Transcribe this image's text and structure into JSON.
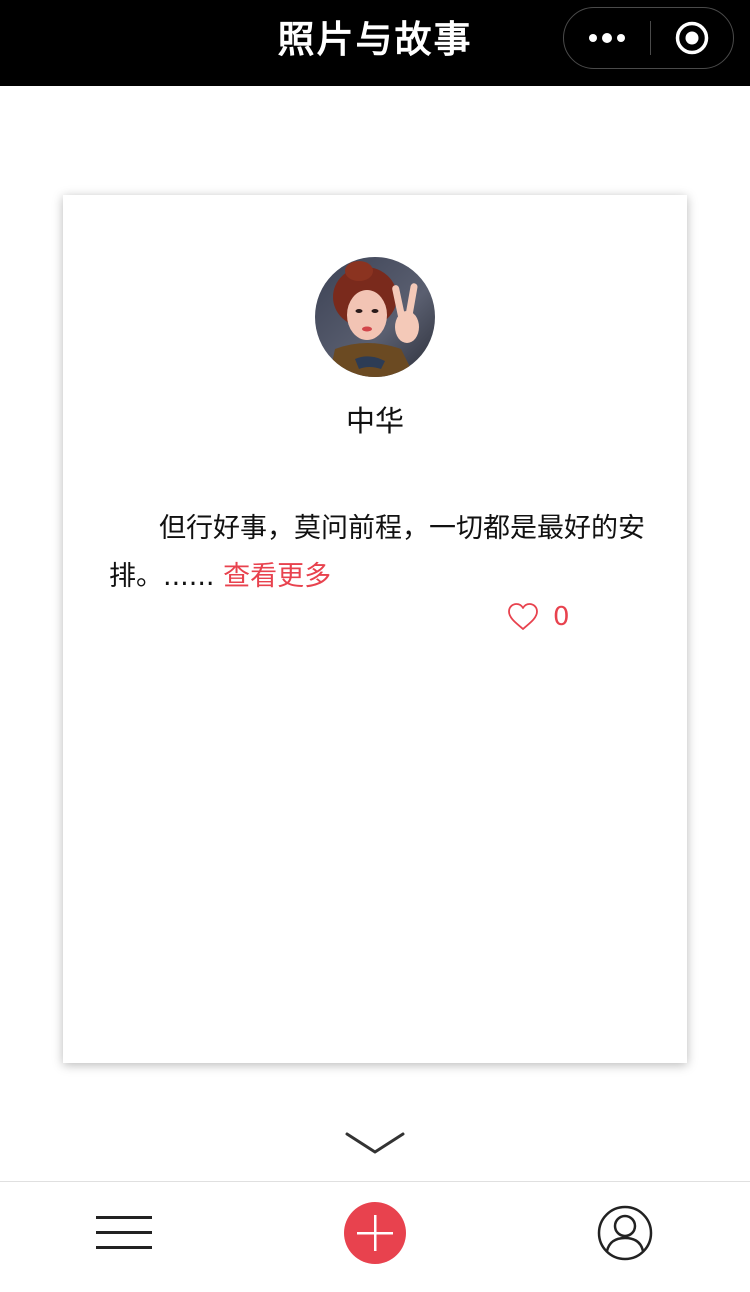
{
  "navbar": {
    "title": "照片与故事",
    "more_icon": "ellipsis-icon",
    "close_icon": "target-circle-icon"
  },
  "card": {
    "author": "中华",
    "story_text": "但行好事，莫问前程，一切都是最好的安排。......",
    "more_link": "查看更多",
    "like_count": "0",
    "like_icon": "heart-outline-icon"
  },
  "tabbar": {
    "items": [
      {
        "icon": "menu-icon"
      },
      {
        "icon": "add-icon"
      },
      {
        "icon": "user-icon"
      }
    ]
  },
  "colors": {
    "accent": "#e8424e",
    "navbar_bg": "#000000",
    "text": "#111111"
  }
}
